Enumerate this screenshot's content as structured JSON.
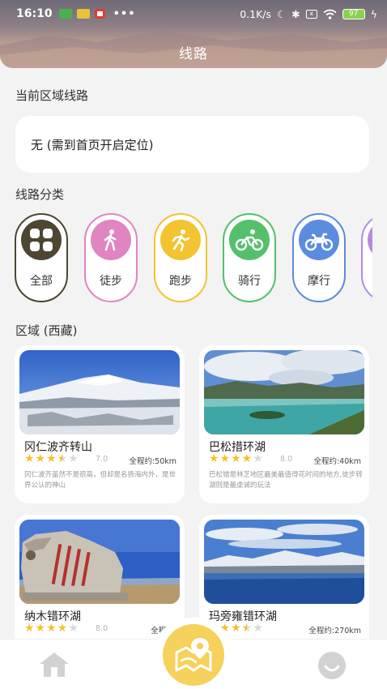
{
  "status_bar": {
    "time": "16:10",
    "speed": "0.1K/s",
    "battery": "97",
    "icons": [
      "app-icon-green",
      "app-icon-yellow",
      "app-icon-red",
      "more-icon",
      "moon-icon",
      "bluetooth-icon",
      "sim-icon",
      "wifi-icon",
      "battery-icon",
      "charging-icon"
    ]
  },
  "header": {
    "title": "线路"
  },
  "current_area": {
    "label": "当前区域线路",
    "message": "无 (需到首页开启定位)"
  },
  "categories": {
    "label": "线路分类",
    "items": [
      {
        "label": "全部",
        "icon": "grid-icon",
        "color": "#4d4631"
      },
      {
        "label": "徒步",
        "icon": "walking-icon",
        "color": "#e085c1"
      },
      {
        "label": "跑步",
        "icon": "running-icon",
        "color": "#f2c431"
      },
      {
        "label": "骑行",
        "icon": "bicycle-icon",
        "color": "#54c06b"
      },
      {
        "label": "摩行",
        "icon": "motorcycle-icon",
        "color": "#5b8cde"
      },
      {
        "label": "",
        "icon": "more-category-icon",
        "color": "#b48de0"
      }
    ]
  },
  "region": {
    "label": "区域 (西藏)",
    "routes": [
      {
        "name": "冈仁波齐转山",
        "stars": 3.5,
        "rating": "7.0",
        "distance": "全程约:50km",
        "description": "冈仁波齐虽然不是很高，但却是名扬海内外，是世界公认的神山",
        "photo": "snow-mountain-photo"
      },
      {
        "name": "巴松措环湖",
        "stars": 4,
        "rating": "8.0",
        "distance": "全程约:40km",
        "description": "巴松错是林芝地区最美最值得花时间的地方,徒步转湖则是最虔诚的玩法",
        "photo": "lake-island-photo"
      },
      {
        "name": "纳木错环湖",
        "stars": 4,
        "rating": "8.0",
        "distance": "全程约:",
        "description": "",
        "photo": "stone-monument-photo"
      },
      {
        "name": "玛旁雍错环湖",
        "stars": 3.5,
        "rating": "",
        "distance": "全程约:270km",
        "description": "",
        "photo": "sacred-lake-photo"
      }
    ]
  },
  "bottom_nav": {
    "items": [
      {
        "icon": "home-icon"
      },
      {
        "icon": "map-route-icon",
        "active": true,
        "color": "#f6d15b"
      },
      {
        "icon": "profile-icon"
      }
    ]
  }
}
